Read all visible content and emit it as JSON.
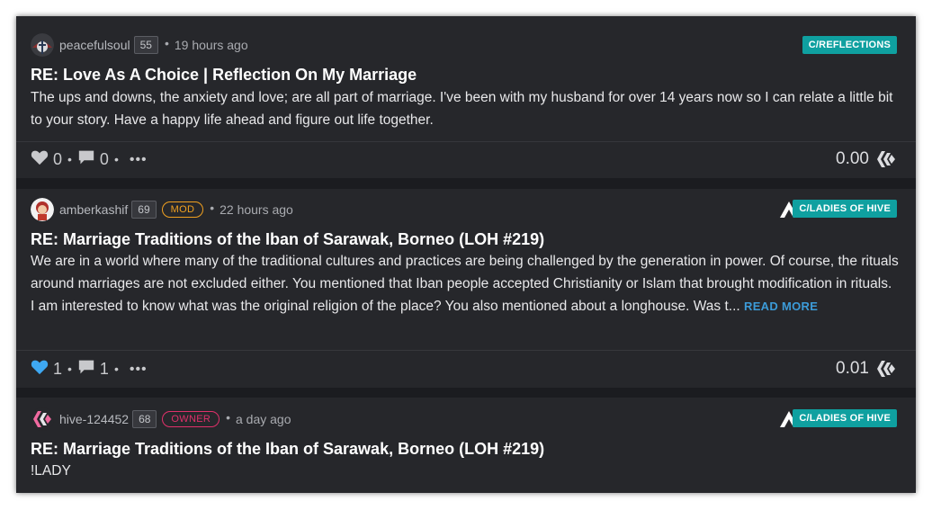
{
  "colors": {
    "community_badge": "#0fa0a0",
    "mod_badge": "#f0a020",
    "owner_badge": "#e0306a",
    "read_more": "#3c9bd8",
    "liked_heart": "#3ea8f2"
  },
  "posts": [
    {
      "author": "peacefulsoul",
      "reputation": "55",
      "role": "",
      "separator": "•",
      "time": "19 hours ago",
      "community": "C/REFLECTIONS",
      "title": "RE: Love As A Choice | Reflection On My Marriage",
      "body": "The ups and downs, the anxiety and love; are all part of marriage. I've been with my husband for over 14 years now so I can relate a little bit to your story. Have a happy life ahead and figure out life together.",
      "read_more": "",
      "votes": "0",
      "comments": "0",
      "payout": "0.00",
      "heart_icon": "heart-icon",
      "liked": false
    },
    {
      "author": "amberkashif",
      "reputation": "69",
      "role": "MOD",
      "separator": "•",
      "time": "22 hours ago",
      "community": "C/LADIES OF HIVE",
      "title": "RE: Marriage Traditions of the Iban of Sarawak, Borneo (LOH #219)",
      "body": "We are in a world where many of the traditional cultures and practices are being challenged by the generation in power. Of course, the rituals around marriages are not excluded either. You mentioned that Iban people accepted Christianity or Islam that brought modification in rituals. I am interested to know what was the original religion of the place? You also mentioned about a longhouse. Was t...",
      "read_more": "READ MORE",
      "votes": "1",
      "comments": "1",
      "payout": "0.01",
      "heart_icon": "heart-icon",
      "liked": true
    },
    {
      "author": "hive-124452",
      "reputation": "68",
      "role": "OWNER",
      "separator": "•",
      "time": "a day ago",
      "community": "C/LADIES OF HIVE",
      "title": "RE: Marriage Traditions of the Iban of Sarawak, Borneo (LOH #219)",
      "body": "!LADY"
    }
  ],
  "actions": {
    "sep": "•",
    "more": "•••"
  }
}
